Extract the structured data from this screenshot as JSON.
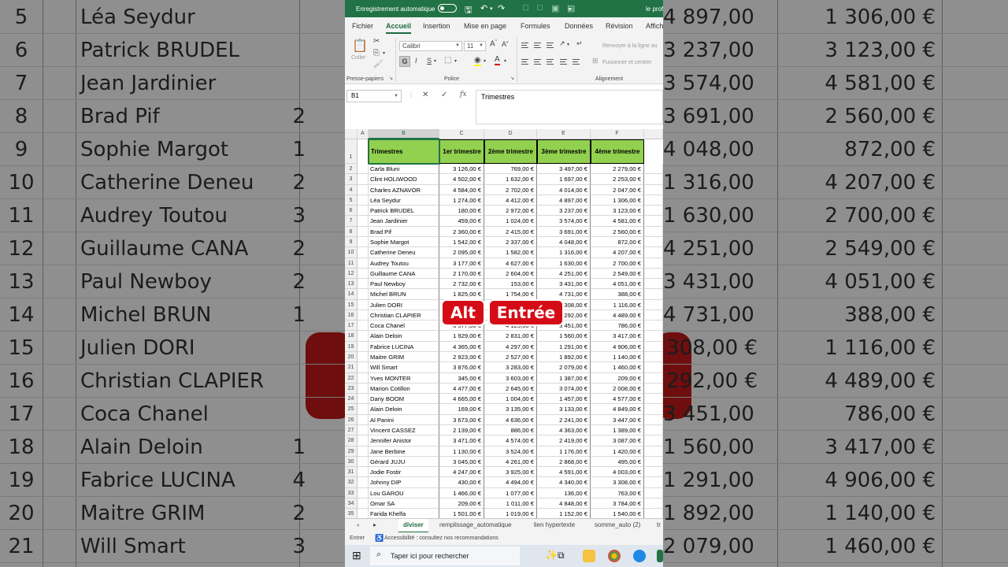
{
  "window": {
    "autosave_label": "Enregistrement automatique",
    "doc_title": "le prof",
    "ribbon_tabs": [
      "Fichier",
      "Accueil",
      "Insertion",
      "Mise en page",
      "Formules",
      "Données",
      "Révision",
      "Afficha"
    ],
    "active_tab": "Accueil"
  },
  "ribbon": {
    "coller_label": "Coller",
    "clipboard_group": "Presse-papiers",
    "font_name": "Calibri",
    "font_size": "11",
    "bold": "G",
    "italic": "I",
    "underline": "S",
    "font_group": "Police",
    "wrap_text": "Renvoyer à la ligne au",
    "merge_center": "Fusionner et centrer",
    "alignment_group": "Alignement"
  },
  "formula_bar": {
    "name_box": "B1",
    "formula": "Trimestres"
  },
  "grid": {
    "column_headers": [
      "A",
      "B",
      "C",
      "D",
      "E",
      "F"
    ],
    "header_row": [
      "Trimestres",
      "1er trimestre",
      "2ème trimestre",
      "3ème trimestre",
      "4ème trimestre"
    ],
    "rows": [
      {
        "n": "2",
        "name": "Carla Bluni",
        "q1": "3 126,00 €",
        "q2": "769,00 €",
        "q3": "3 497,00 €",
        "q4": "2 279,00 €"
      },
      {
        "n": "3",
        "name": "Clint HOLIWOOD",
        "q1": "4 502,00 €",
        "q2": "1 632,00 €",
        "q3": "1 697,00 €",
        "q4": "2 253,00 €"
      },
      {
        "n": "4",
        "name": "Charles AZNAVOR",
        "q1": "4 584,00 €",
        "q2": "2 702,00 €",
        "q3": "4 014,00 €",
        "q4": "2 047,00 €"
      },
      {
        "n": "5",
        "name": "Léa Seydur",
        "q1": "1 274,00 €",
        "q2": "4 412,00 €",
        "q3": "4 897,00 €",
        "q4": "1 306,00 €"
      },
      {
        "n": "6",
        "name": "Patrick BRUDEL",
        "q1": "180,00 €",
        "q2": "2 972,00 €",
        "q3": "3 237,00 €",
        "q4": "3 123,00 €"
      },
      {
        "n": "7",
        "name": "Jean Jardinier",
        "q1": "459,00 €",
        "q2": "1 024,00 €",
        "q3": "3 574,00 €",
        "q4": "4 581,00 €"
      },
      {
        "n": "8",
        "name": "Brad Pif",
        "q1": "2 360,00 €",
        "q2": "2 415,00 €",
        "q3": "3 691,00 €",
        "q4": "2 560,00 €"
      },
      {
        "n": "9",
        "name": "Sophie Margot",
        "q1": "1 542,00 €",
        "q2": "2 337,00 €",
        "q3": "4 048,00 €",
        "q4": "872,00 €"
      },
      {
        "n": "10",
        "name": "Catherine Deneu",
        "q1": "2 095,00 €",
        "q2": "1 582,00 €",
        "q3": "1 316,00 €",
        "q4": "4 207,00 €"
      },
      {
        "n": "11",
        "name": "Audrey Toutou",
        "q1": "3 177,00 €",
        "q2": "4 627,00 €",
        "q3": "1 630,00 €",
        "q4": "2 700,00 €"
      },
      {
        "n": "12",
        "name": "Guillaume CANA",
        "q1": "2 170,00 €",
        "q2": "2 604,00 €",
        "q3": "4 251,00 €",
        "q4": "2 549,00 €"
      },
      {
        "n": "13",
        "name": "Paul Newboy",
        "q1": "2 732,00 €",
        "q2": "153,00 €",
        "q3": "3 431,00 €",
        "q4": "4 051,00 €"
      },
      {
        "n": "14",
        "name": "Michel BRUN",
        "q1": "1 825,00 €",
        "q2": "1 754,00 €",
        "q3": "4 731,00 €",
        "q4": "388,00 €"
      },
      {
        "n": "15",
        "name": "Julien DORI",
        "q1": "",
        "q2": "",
        "q3": "4 308,00 €",
        "q4": "1 116,00 €"
      },
      {
        "n": "16",
        "name": "Christian CLAPIER",
        "q1": "",
        "q2": "",
        "q3": "1 292,00 €",
        "q4": "4 489,00 €"
      },
      {
        "n": "17",
        "name": "Coca Chanel",
        "q1": "3 577,00 €",
        "q2": "4 125,00 €",
        "q3": "3 451,00 €",
        "q4": "786,00 €"
      },
      {
        "n": "18",
        "name": "Alain Deloin",
        "q1": "1 929,00 €",
        "q2": "2 831,00 €",
        "q3": "1 560,00 €",
        "q4": "3 417,00 €"
      },
      {
        "n": "19",
        "name": "Fabrice LUCINA",
        "q1": "4 365,00 €",
        "q2": "4 297,00 €",
        "q3": "1 291,00 €",
        "q4": "4 906,00 €"
      },
      {
        "n": "20",
        "name": "Maitre GRIM",
        "q1": "2 923,00 €",
        "q2": "2 527,00 €",
        "q3": "1 892,00 €",
        "q4": "1 140,00 €"
      },
      {
        "n": "21",
        "name": "Will Smart",
        "q1": "3 876,00 €",
        "q2": "3 283,00 €",
        "q3": "2 079,00 €",
        "q4": "1 460,00 €"
      },
      {
        "n": "22",
        "name": "Yves MONTER",
        "q1": "345,00 €",
        "q2": "3 603,00 €",
        "q3": "1 387,00 €",
        "q4": "209,00 €"
      },
      {
        "n": "23",
        "name": "Marion Cotillon",
        "q1": "4 477,00 €",
        "q2": "2 645,00 €",
        "q3": "3 074,00 €",
        "q4": "2 008,00 €"
      },
      {
        "n": "24",
        "name": "Dany BOOM",
        "q1": "4 665,00 €",
        "q2": "1 004,00 €",
        "q3": "1 457,00 €",
        "q4": "4 577,00 €"
      },
      {
        "n": "25",
        "name": "Alain Deloin",
        "q1": "169,00 €",
        "q2": "3 135,00 €",
        "q3": "3 133,00 €",
        "q4": "4 849,00 €"
      },
      {
        "n": "26",
        "name": "Al Panini",
        "q1": "3 673,00 €",
        "q2": "4 636,00 €",
        "q3": "2 241,00 €",
        "q4": "3 447,00 €"
      },
      {
        "n": "27",
        "name": "Vincent CASSEZ",
        "q1": "2 139,00 €",
        "q2": "886,00 €",
        "q3": "4 363,00 €",
        "q4": "1 389,00 €"
      },
      {
        "n": "28",
        "name": "Jennifer Anistor",
        "q1": "3 471,00 €",
        "q2": "4 574,00 €",
        "q3": "2 419,00 €",
        "q4": "3 087,00 €"
      },
      {
        "n": "29",
        "name": "Jane Berbine",
        "q1": "1 130,00 €",
        "q2": "3 524,00 €",
        "q3": "1 176,00 €",
        "q4": "1 420,00 €"
      },
      {
        "n": "30",
        "name": "Gérard JUJU",
        "q1": "3 045,00 €",
        "q2": "4 261,00 €",
        "q3": "2 868,00 €",
        "q4": "495,00 €"
      },
      {
        "n": "31",
        "name": "Jodie Fostir",
        "q1": "4 247,00 €",
        "q2": "3 925,00 €",
        "q3": "4 591,00 €",
        "q4": "4 003,00 €"
      },
      {
        "n": "32",
        "name": "Johnny DIP",
        "q1": "430,00 €",
        "q2": "4 494,00 €",
        "q3": "4 340,00 €",
        "q4": "3 308,00 €"
      },
      {
        "n": "33",
        "name": "Lou GAROU",
        "q1": "1 466,00 €",
        "q2": "1 077,00 €",
        "q3": "136,00 €",
        "q4": "763,00 €"
      },
      {
        "n": "34",
        "name": "Omar SA",
        "q1": "209,00 €",
        "q2": "1 011,00 €",
        "q3": "4 848,00 €",
        "q4": "3 784,00 €"
      },
      {
        "n": "35",
        "name": "Farida Khelfa",
        "q1": "1 501,00 €",
        "q2": "1 019,00 €",
        "q3": "1 152,00 €",
        "q4": "1 540,00 €"
      }
    ]
  },
  "sheet_tabs": [
    "diviser",
    "remplissage_automatique",
    "lien hypertexte",
    "somme_auto (2)",
    "tr"
  ],
  "active_sheet": "diviser",
  "status": {
    "mode": "Entrer",
    "accessibility": "Accessibilité : consultez nos recommandations"
  },
  "taskbar": {
    "search_placeholder": "Taper ici pour rechercher"
  },
  "overlay": {
    "key1": "Alt",
    "key2": "Entrée",
    "color": "#d50c16"
  },
  "background_zoom": {
    "rows": [
      {
        "n": "5",
        "name": "Léa Seydur",
        "left_frag": "",
        "q3": "4 897,00 €",
        "q4": "1 306,00 €"
      },
      {
        "n": "6",
        "name": "Patrick BRUDEL",
        "left_frag": "",
        "q3": "3 237,00 €",
        "q4": "3 123,00 €"
      },
      {
        "n": "7",
        "name": "Jean Jardinier",
        "left_frag": "",
        "q3": "3 574,00 €",
        "q4": "4 581,00 €"
      },
      {
        "n": "8",
        "name": "Brad Pif",
        "left_frag": "2",
        "q3": "3 691,00 €",
        "q4": "2 560,00 €"
      },
      {
        "n": "9",
        "name": "Sophie Margot",
        "left_frag": "1",
        "q3": "4 048,00 €",
        "q4": "872,00 €"
      },
      {
        "n": "10",
        "name": "Catherine Deneu",
        "left_frag": "2",
        "q3": "1 316,00 €",
        "q4": "4 207,00 €"
      },
      {
        "n": "11",
        "name": "Audrey Toutou",
        "left_frag": "3",
        "q3": "1 630,00 €",
        "q4": "2 700,00 €"
      },
      {
        "n": "12",
        "name": "Guillaume CANA",
        "left_frag": "2",
        "q3": "4 251,00 €",
        "q4": "2 549,00 €"
      },
      {
        "n": "13",
        "name": "Paul Newboy",
        "left_frag": "2",
        "q3": "3 431,00 €",
        "q4": "4 051,00 €"
      },
      {
        "n": "14",
        "name": "Michel BRUN",
        "left_frag": "1",
        "q3": "4 731,00 €",
        "q4": "388,00 €"
      },
      {
        "n": "15",
        "name": "Julien DORI",
        "left_frag": "",
        "q3": "308,00 €",
        "q4": "1 116,00 €"
      },
      {
        "n": "16",
        "name": "Christian CLAPIER",
        "left_frag": "",
        "q3": "292,00 €",
        "q4": "4 489,00 €"
      },
      {
        "n": "17",
        "name": "Coca Chanel",
        "left_frag": "",
        "q3": "3 451,00 €",
        "q4": "786,00 €"
      },
      {
        "n": "18",
        "name": "Alain Deloin",
        "left_frag": "1",
        "q3": "1 560,00 €",
        "q4": "3 417,00 €"
      },
      {
        "n": "19",
        "name": "Fabrice LUCINA",
        "left_frag": "4",
        "q3": "1 291,00 €",
        "q4": "4 906,00 €"
      },
      {
        "n": "20",
        "name": "Maitre GRIM",
        "left_frag": "2",
        "q3": "1 892,00 €",
        "q4": "1 140,00 €"
      },
      {
        "n": "21",
        "name": "Will Smart",
        "left_frag": "3",
        "q3": "2 079,00 €",
        "q4": "1 460,00 €"
      }
    ]
  }
}
